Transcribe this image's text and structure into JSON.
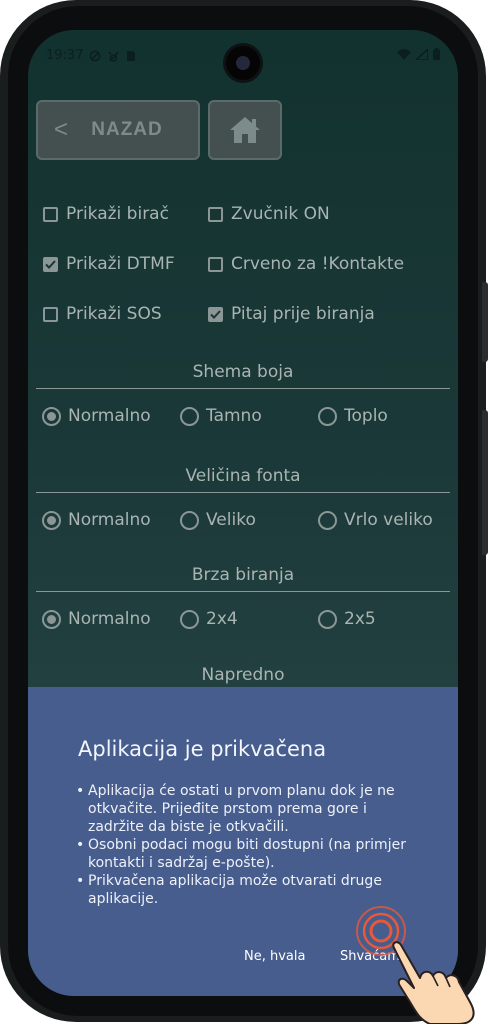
{
  "status_bar": {
    "time": "19:37"
  },
  "header": {
    "back_label": "NAZAD"
  },
  "checkboxes": [
    {
      "label": "Prikaži birač",
      "checked": false
    },
    {
      "label": "Zvučnik ON",
      "checked": false
    },
    {
      "label": "Prikaži DTMF",
      "checked": true
    },
    {
      "label": "Crveno za !Kontakte",
      "checked": false
    },
    {
      "label": "Prikaži SOS",
      "checked": false
    },
    {
      "label": "Pitaj prije biranja",
      "checked": true
    }
  ],
  "color_scheme": {
    "title": "Shema boja",
    "options": [
      "Normalno",
      "Tamno",
      "Toplo"
    ],
    "selected": "Normalno"
  },
  "font_size": {
    "title": "Veličina fonta",
    "options": [
      "Normalno",
      "Veliko",
      "Vrlo veliko"
    ],
    "selected": "Normalno"
  },
  "speed_dial": {
    "title": "Brza biranja",
    "options": [
      "Normalno",
      "2x4",
      "2x5"
    ],
    "selected": "Normalno"
  },
  "advanced": {
    "title": "Napredno"
  },
  "dialog": {
    "title": "Aplikacija je prikvačena",
    "bullets": [
      "Aplikacija će ostati u prvom planu dok je ne otkvačite. Prijeđite prstom prema gore i zadržite da biste je otkvačili.",
      "Osobni podaci mogu biti dostupni (na primjer kontakti i sadržaj e-pošte).",
      "Prikvačena aplikacija može otvarati druge aplikacije."
    ],
    "decline_label": "Ne, hvala",
    "accept_label": "Shvaćam"
  },
  "colors": {
    "background_top": "#12322f",
    "dialog": "#475d8e",
    "text_muted": "#a9b4b3",
    "touch_ring": "#e8593a"
  }
}
